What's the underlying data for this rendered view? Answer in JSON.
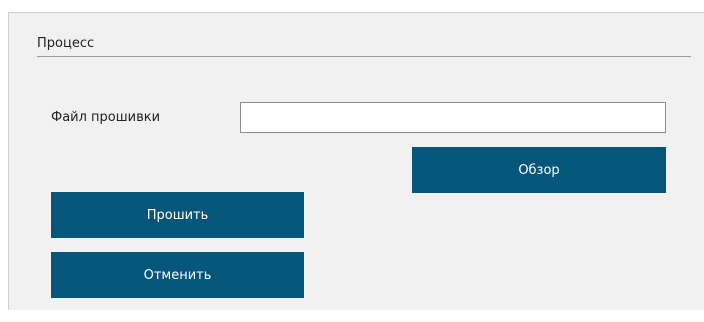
{
  "section": {
    "title": "Процесс"
  },
  "firmware": {
    "label": "Файл прошивки",
    "value": "",
    "placeholder": ""
  },
  "buttons": {
    "browse": "Обзор",
    "flash": "Прошить",
    "cancel": "Отменить"
  },
  "colors": {
    "button_bg": "#06557b",
    "button_text": "#ffffff",
    "panel_bg": "#f1f1f1"
  }
}
